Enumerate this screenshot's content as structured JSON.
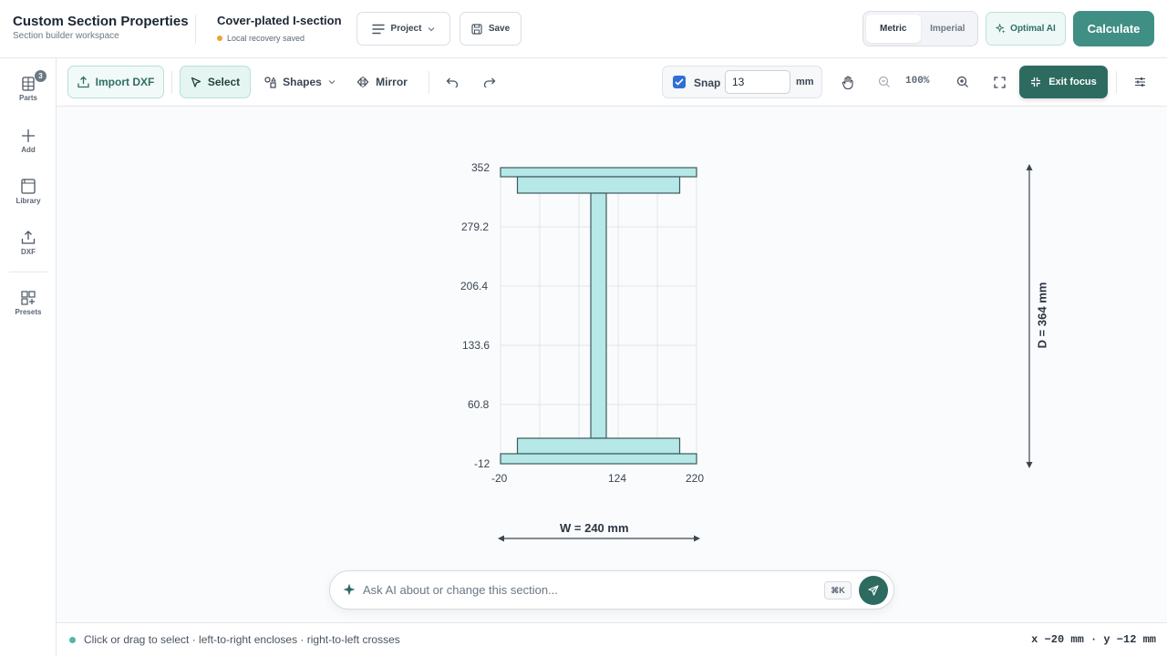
{
  "app": {
    "title": "Custom Section Properties",
    "subtitle": "Section builder workspace"
  },
  "document": {
    "title": "Cover-plated I-section",
    "status": "Local recovery saved"
  },
  "header": {
    "project_label": "Project",
    "save_label": "Save",
    "units": [
      "Metric",
      "Imperial"
    ],
    "active_unit": "Metric",
    "ai_label": "Optimal AI",
    "calculate_label": "Calculate"
  },
  "sidebar": {
    "items": [
      {
        "label": "Parts",
        "icon": "parts-icon",
        "badge": "3"
      },
      {
        "label": "Add",
        "icon": "plus-icon"
      },
      {
        "label": "Library",
        "icon": "library-icon"
      },
      {
        "label": "DXF",
        "icon": "upload-icon"
      },
      {
        "label": "Presets",
        "icon": "presets-icon"
      }
    ]
  },
  "toolbar": {
    "import_label": "Import DXF",
    "select_label": "Select",
    "shapes_label": "Shapes",
    "mirror_label": "Mirror",
    "snap_label": "Snap",
    "snap_checked": true,
    "snap_value": "13",
    "snap_unit": "mm",
    "zoom": "100%",
    "exit_focus_label": "Exit focus"
  },
  "canvas": {
    "y_ticks": [
      "352",
      "279.2",
      "206.4",
      "133.6",
      "60.8",
      "-12"
    ],
    "x_ticks": [
      "-20",
      "124",
      "220"
    ],
    "width_dimension": "W = 240 mm",
    "depth_dimension": "D = 364 mm"
  },
  "ai_bar": {
    "placeholder": "Ask AI about or change this section...",
    "shortcut": "⌘K"
  },
  "status": {
    "hint": "Click or drag to select · left-to-right encloses · right-to-left crosses",
    "coords": "x −20 mm · y −12 mm"
  },
  "colors": {
    "accent": "#3f8f84",
    "accent_dark": "#2d6b61",
    "shape_fill": "#b5e8e6",
    "shape_stroke": "#3c5a5c"
  }
}
